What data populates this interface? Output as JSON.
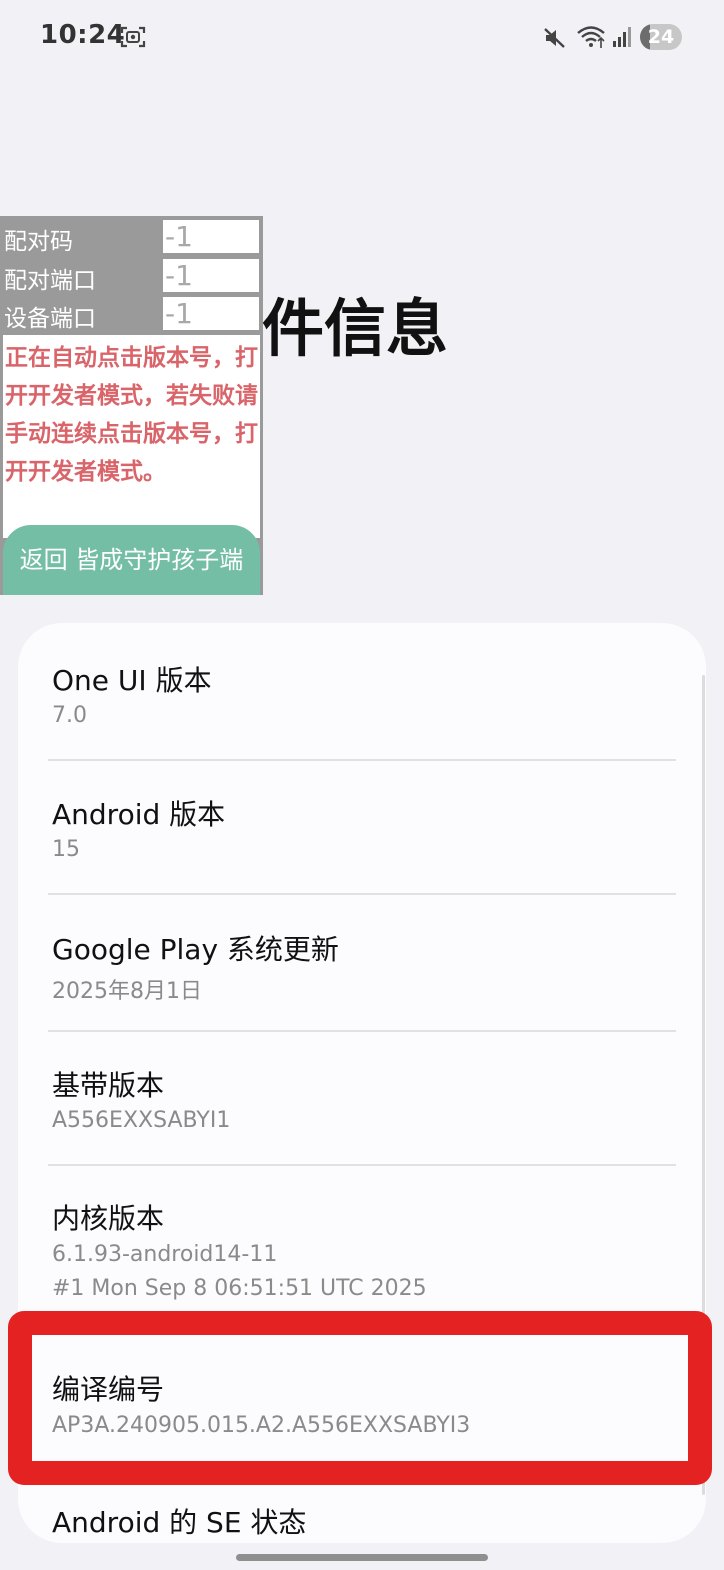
{
  "status_bar": {
    "time": "10:24",
    "battery": "24",
    "icons": [
      "screenshot-icon",
      "mute-icon",
      "wifi-icon",
      "signal-icon"
    ]
  },
  "page": {
    "title": "软件信息"
  },
  "overlay": {
    "pair_code_label": "配对码",
    "pair_code_value": "-1",
    "pair_port_label": "配对端口",
    "pair_port_value": "-1",
    "device_port_label": "设备端口",
    "device_port_value": "-1",
    "message": "正在自动点击版本号，打开开发者模式，若失败请手动连续点击版本号，打开开发者模式。",
    "back_button": "返回 皆成守护孩子端"
  },
  "settings": {
    "one_ui": {
      "title": "One UI 版本",
      "value": "7.0"
    },
    "android": {
      "title": "Android 版本",
      "value": "15"
    },
    "google_play": {
      "title": "Google Play 系统更新",
      "value": "2025年8月1日"
    },
    "baseband": {
      "title": "基带版本",
      "value": "A556EXXSABYI1"
    },
    "kernel": {
      "title": "内核版本",
      "value_line1": "6.1.93-android14-11",
      "value_line2": "#1 Mon Sep  8 06:51:51 UTC 2025"
    },
    "build_number": {
      "title": "编译编号",
      "value": "AP3A.240905.015.A2.A556EXXSABYI3"
    },
    "se_status": {
      "title": "Android 的 SE 状态"
    }
  },
  "colors": {
    "background": "#f2f2f6",
    "card": "#fcfcfe",
    "overlay": "#9a9a9a",
    "message_text": "#d9646a",
    "back_button": "#75bea6",
    "highlight": "#e52222"
  }
}
